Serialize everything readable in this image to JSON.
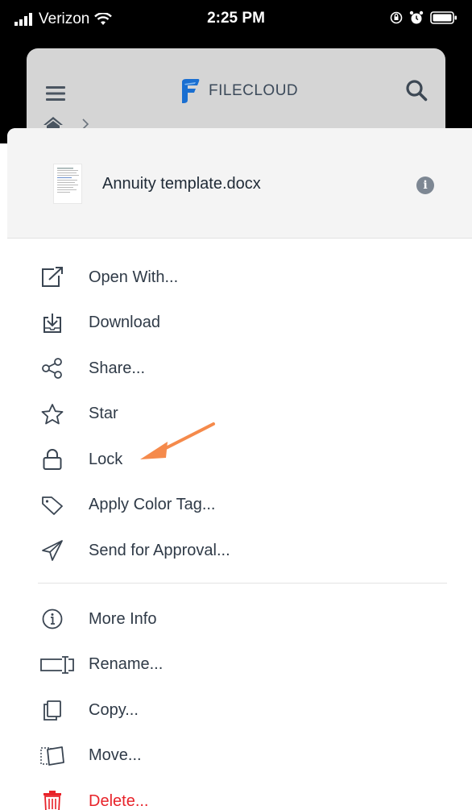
{
  "status_bar": {
    "carrier": "Verizon",
    "time": "2:25 PM"
  },
  "app_header": {
    "logo_text": "FILECLOUD"
  },
  "file": {
    "name": "Annuity template.docx"
  },
  "menu_group_1": [
    {
      "label": "Open With...",
      "icon": "open-external-icon"
    },
    {
      "label": "Download",
      "icon": "download-icon"
    },
    {
      "label": "Share...",
      "icon": "share-icon"
    },
    {
      "label": "Star",
      "icon": "star-icon"
    },
    {
      "label": "Lock",
      "icon": "lock-icon"
    },
    {
      "label": "Apply Color Tag...",
      "icon": "tag-icon"
    },
    {
      "label": "Send for Approval...",
      "icon": "send-icon"
    }
  ],
  "menu_group_2": [
    {
      "label": "More Info",
      "icon": "info-circle-icon"
    },
    {
      "label": "Rename...",
      "icon": "rename-icon"
    },
    {
      "label": "Copy...",
      "icon": "copy-icon"
    },
    {
      "label": "Move...",
      "icon": "move-icon"
    },
    {
      "label": "Delete...",
      "icon": "trash-icon"
    }
  ],
  "colors": {
    "annotation_arrow": "#f58a4b",
    "danger": "#e8232a",
    "text": "#2f3a47",
    "logo_blue": "#1a6fd1"
  }
}
